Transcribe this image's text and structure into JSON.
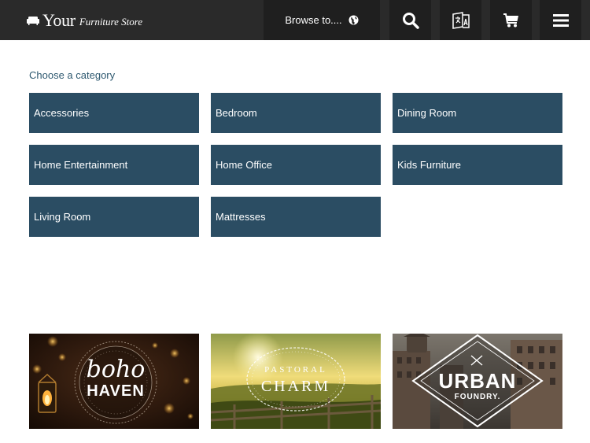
{
  "header": {
    "brand_word": "Your",
    "brand_tagline": "Furniture Store",
    "browse_label": "Browse to....",
    "icons": [
      "sofa-icon",
      "globe-icon",
      "search-icon",
      "translate-icon",
      "cart-icon",
      "menu-icon"
    ]
  },
  "categories": {
    "heading": "Choose a category",
    "items": [
      {
        "label": "Accessories"
      },
      {
        "label": "Bedroom"
      },
      {
        "label": "Dining Room"
      },
      {
        "label": "Home Entertainment"
      },
      {
        "label": "Home Office"
      },
      {
        "label": "Kids Furniture"
      },
      {
        "label": "Living Room"
      },
      {
        "label": "Mattresses"
      }
    ]
  },
  "promos": [
    {
      "line1": "boho",
      "line2": "HAVEN"
    },
    {
      "line1": "PASTORAL",
      "line2": "CHARM"
    },
    {
      "line1": "URBAN",
      "line2": "FOUNDRY."
    }
  ],
  "colors": {
    "header_bg": "#2a2a2a",
    "tile_bg": "#2b4d63",
    "link_text": "#2e5970"
  }
}
